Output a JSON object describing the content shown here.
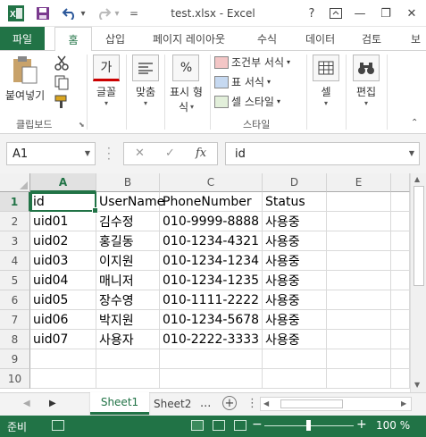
{
  "window": {
    "title": "test.xlsx - Excel",
    "help": "?",
    "minimize": "—",
    "restore": "❐",
    "close": "✕"
  },
  "quick_access": {
    "undo_dropdown": "▾",
    "redo_dropdown": "▾",
    "customize": "="
  },
  "ribbon_tabs": {
    "file": "파일",
    "home": "홈",
    "insert": "삽입",
    "page_layout": "페이지 레이아웃",
    "formulas": "수식",
    "data": "데이터",
    "review": "검토",
    "overflow": "보"
  },
  "ribbon": {
    "paste_label": "붙여넣기",
    "clipboard_group": "클립보드",
    "font_icon": "가",
    "font_label": "글꼴",
    "align_label": "맞춤",
    "number_icon": "%",
    "number_label_1": "표시 형",
    "number_label_2": "식",
    "conditional_format": "조건부 서식",
    "format_as_table": "표 서식",
    "cell_styles": "셀 스타일",
    "styles_group": "스타일",
    "cells_label": "셀",
    "editing_label": "편집"
  },
  "formula_bar": {
    "name_box": "A1",
    "cancel": "✕",
    "enter": "✓",
    "fx": "fx",
    "value": "id"
  },
  "grid": {
    "columns": [
      "A",
      "B",
      "C",
      "D",
      "E"
    ],
    "rows": [
      "1",
      "2",
      "3",
      "4",
      "5",
      "6",
      "7",
      "8",
      "9",
      "10"
    ],
    "cells": [
      [
        "id",
        "UserName",
        "PhoneNumber",
        "Status"
      ],
      [
        "uid01",
        "김수정",
        "010-9999-8888",
        "사용중"
      ],
      [
        "uid02",
        "홍길동",
        "010-1234-4321",
        "사용중"
      ],
      [
        "uid03",
        "이지원",
        "010-1234-1234",
        "사용중"
      ],
      [
        "uid04",
        "매니저",
        "010-1234-1235",
        "사용중"
      ],
      [
        "uid05",
        "장수영",
        "010-1111-2222",
        "사용중"
      ],
      [
        "uid06",
        "박지원",
        "010-1234-5678",
        "사용중"
      ],
      [
        "uid07",
        "사용자",
        "010-2222-3333",
        "사용중"
      ]
    ],
    "active_cell": "A1"
  },
  "sheets": {
    "tabs": [
      "Sheet1",
      "Sheet2"
    ],
    "active": "Sheet1",
    "more": "...",
    "add": "+"
  },
  "status_bar": {
    "status": "준비",
    "zoom_minus": "−",
    "zoom_plus": "+",
    "zoom": "100 %"
  },
  "colors": {
    "accent": "#217346",
    "undo": "#2b579a",
    "save": "#217346"
  }
}
